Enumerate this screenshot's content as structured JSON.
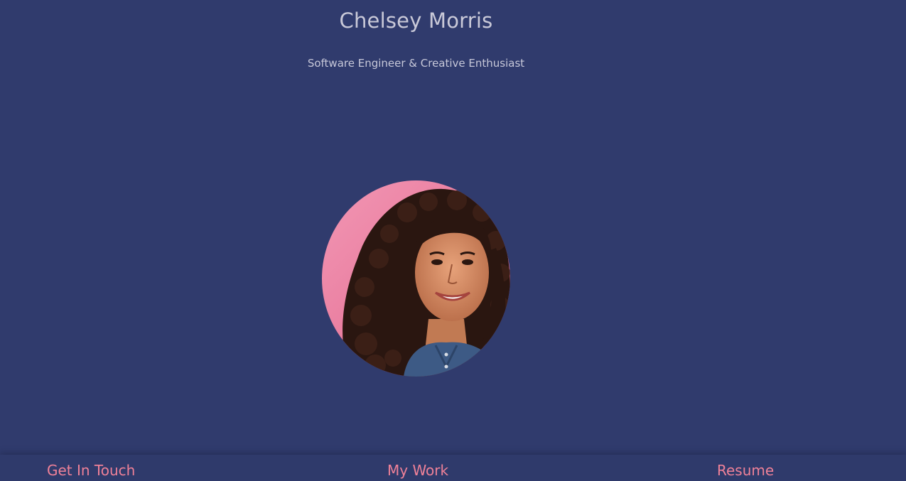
{
  "header": {
    "name": "Chelsey Morris",
    "tagline": "Software Engineer & Creative Enthusiast"
  },
  "profile": {
    "photo_alt": "Portrait photo of Chelsey Morris"
  },
  "nav": {
    "contact_label": "Get In Touch",
    "work_label": "My Work",
    "resume_label": "Resume"
  },
  "colors": {
    "background": "#303b6d",
    "accent": "#ef8198",
    "text": "#c9c9d8"
  }
}
